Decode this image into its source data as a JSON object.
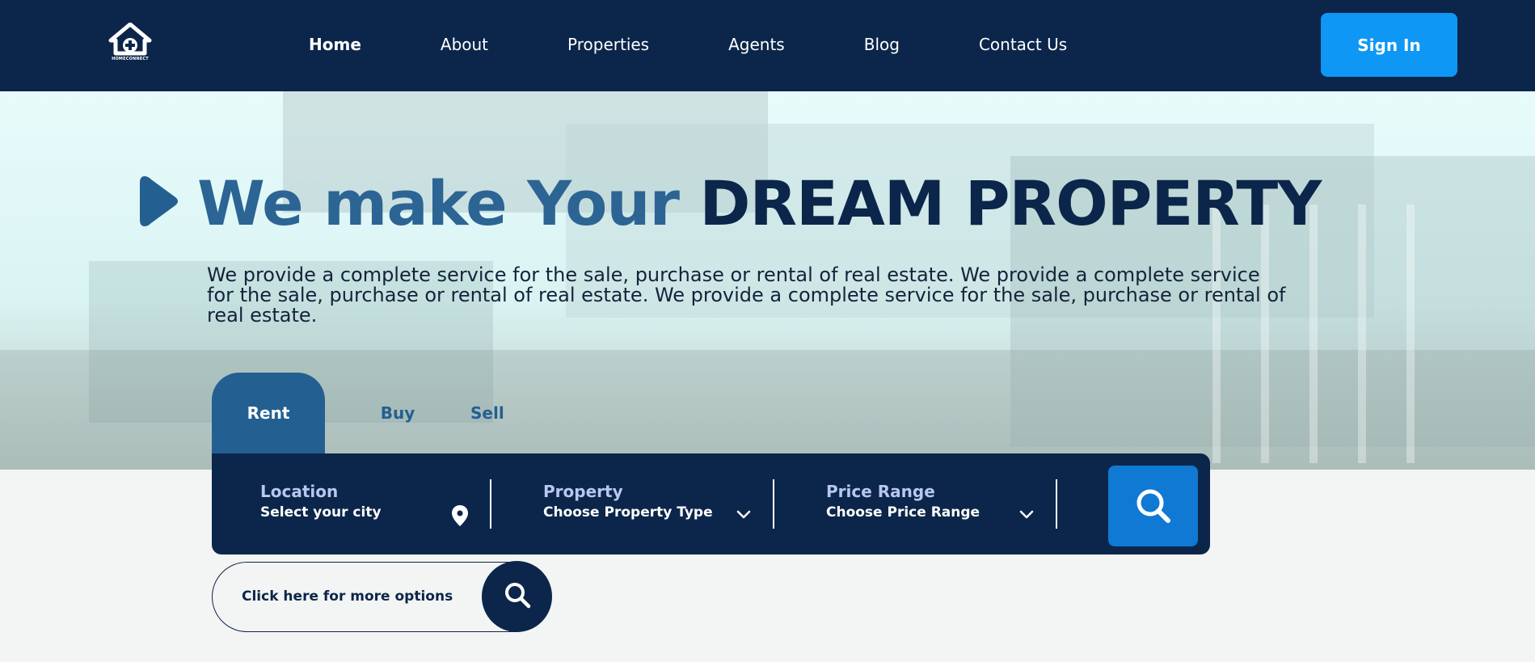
{
  "brand": {
    "logo_text": "HOMECONNECT"
  },
  "nav": {
    "items": [
      {
        "label": "Home"
      },
      {
        "label": "About"
      },
      {
        "label": "Properties"
      },
      {
        "label": "Agents"
      },
      {
        "label": "Blog"
      },
      {
        "label": "Contact Us"
      }
    ],
    "active": "Home"
  },
  "header": {
    "sign_in_label": "Sign In"
  },
  "hero": {
    "headline_light": "We make Your ",
    "headline_dark": "DREAM PROPERTY",
    "description": "We provide a complete service for the sale, purchase or rental of real estate. We provide a complete service for the sale, purchase or rental of real estate. We provide a complete service for the sale, purchase or rental of real estate."
  },
  "search": {
    "tabs": [
      {
        "label": "Rent"
      },
      {
        "label": "Buy"
      },
      {
        "label": "Sell"
      }
    ],
    "active_tab": "Rent",
    "location": {
      "label": "Location",
      "value": "Select your city"
    },
    "property": {
      "label": "Property",
      "value": "Choose Property Type"
    },
    "price": {
      "label": "Price Range",
      "value": "Choose Price Range"
    },
    "more_options_label": "Click here for more options"
  },
  "icons": {
    "logo": "house-plus-icon",
    "play": "play-icon",
    "location": "map-pin-icon",
    "dropdown": "chevron-down-icon",
    "search": "search-icon"
  },
  "colors": {
    "navy": "#0b264a",
    "brand_blue": "#0e97f5",
    "search_blue": "#1079d3",
    "accent_blue": "#2c6494",
    "label_lavender": "#b7c8ec"
  }
}
